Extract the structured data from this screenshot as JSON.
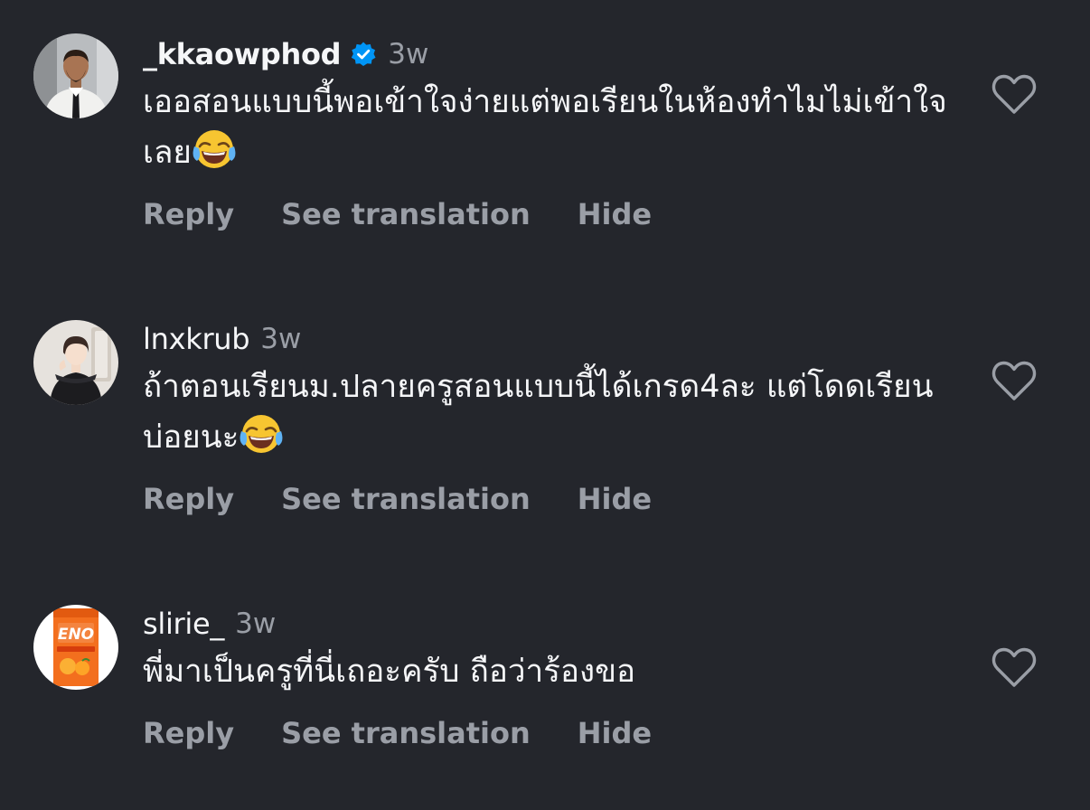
{
  "comments": [
    {
      "username": "_kkaowphod",
      "verified": true,
      "time": "3w",
      "text": "เออสอนแบบนี้พอเข้าใจง่ายแต่พอเรียนในห้องทำไมไม่เข้าใจเลย",
      "emoji": "face-with-tears-of-joy",
      "avatar": "man-in-white-suit",
      "actions": {
        "reply": "Reply",
        "translate": "See translation",
        "hide": "Hide"
      }
    },
    {
      "username": "lnxkrub",
      "verified": false,
      "time": "3w",
      "text": "ถ้าตอนเรียนม.ปลายครูสอนแบบนี้ได้เกรด4ละ แต่โดดเรียนบ่อยนะ",
      "emoji": "face-with-tears-of-joy",
      "avatar": "person-in-black-dress",
      "actions": {
        "reply": "Reply",
        "translate": "See translation",
        "hide": "Hide"
      }
    },
    {
      "username": "slirie_",
      "verified": false,
      "time": "3w",
      "text": "พี่มาเป็นครูที่นี่เถอะครับ ถือว่าร้องขอ",
      "emoji": "",
      "avatar": "eno-sachet",
      "avatar_text": "ENO",
      "actions": {
        "reply": "Reply",
        "translate": "See translation",
        "hide": "Hide"
      }
    }
  ],
  "icons": {
    "verified": "verified-badge-icon",
    "like": "heart-outline-icon"
  },
  "colors": {
    "background": "#24262c",
    "primary_text": "#f5f6f8",
    "secondary_text": "#9a9ea6",
    "verified_blue": "#0095f6"
  }
}
